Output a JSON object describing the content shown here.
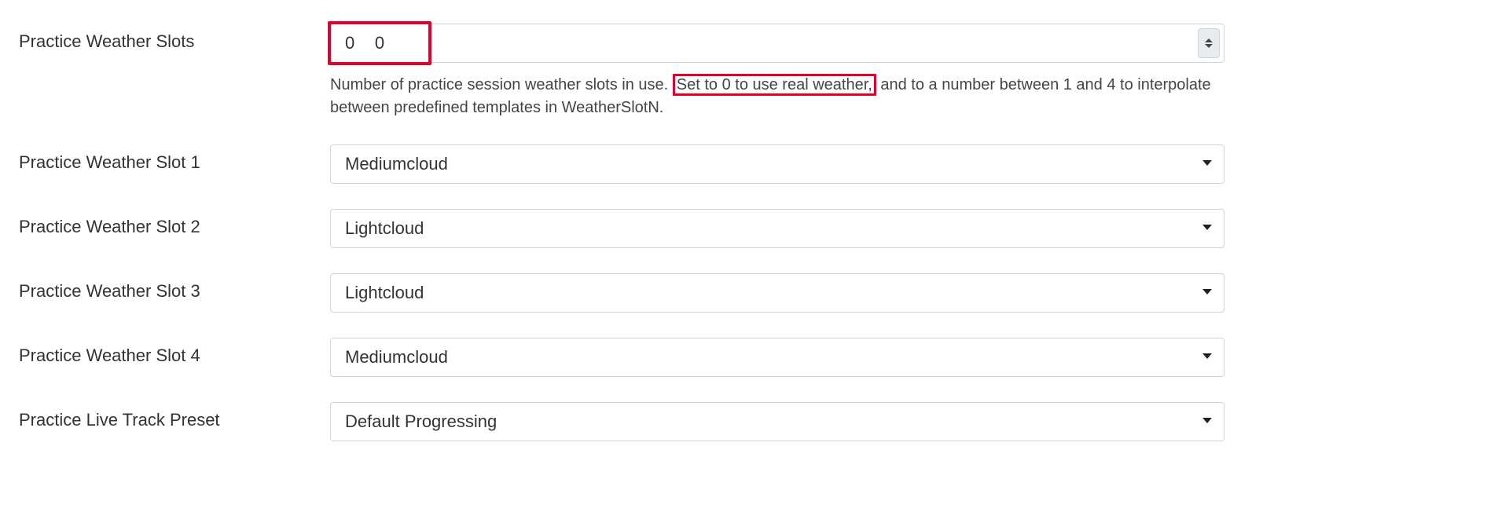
{
  "rows": {
    "slots": {
      "label": "Practice Weather Slots",
      "value": "0",
      "help_pre": "Number of practice session weather slots in use. ",
      "help_box": "Set to 0 to use real weather,",
      "help_post": " and to a number between 1 and 4 to interpolate between predefined templates in WeatherSlotN."
    },
    "slot1": {
      "label": "Practice Weather Slot 1",
      "value": "Mediumcloud"
    },
    "slot2": {
      "label": "Practice Weather Slot 2",
      "value": "Lightcloud"
    },
    "slot3": {
      "label": "Practice Weather Slot 3",
      "value": "Lightcloud"
    },
    "slot4": {
      "label": "Practice Weather Slot 4",
      "value": "Mediumcloud"
    },
    "preset": {
      "label": "Practice Live Track Preset",
      "value": "Default Progressing"
    }
  }
}
